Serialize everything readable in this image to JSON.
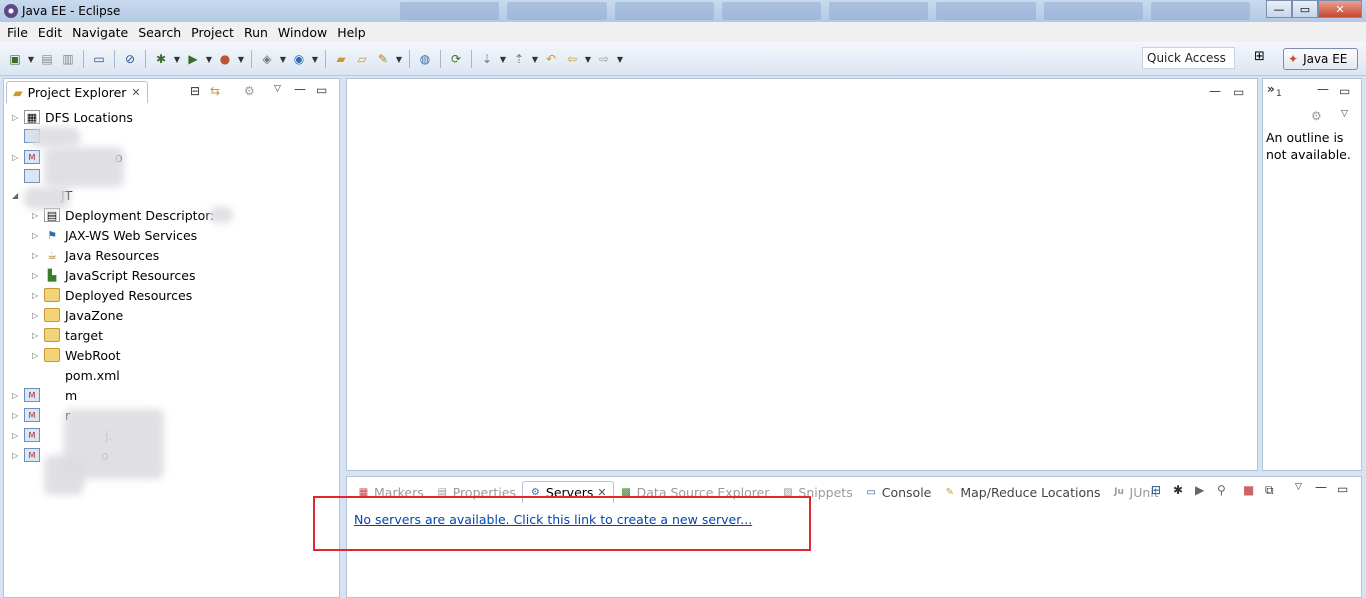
{
  "window": {
    "title": "Java EE - Eclipse",
    "min": "—",
    "max": "▭",
    "close": "✕"
  },
  "menu": [
    "File",
    "Edit",
    "Navigate",
    "Search",
    "Project",
    "Run",
    "Window",
    "Help"
  ],
  "toolbar": {
    "quick_access": "Quick Access",
    "perspective": "Java EE"
  },
  "explorer": {
    "tab_label": "Project Explorer",
    "items": [
      {
        "label": "DFS Locations"
      },
      {
        "label": ""
      },
      {
        "label": "o"
      },
      {
        "label": ""
      },
      {
        "label": "JT"
      },
      {
        "label": "Deployment Descriptor:"
      },
      {
        "label": "JAX-WS Web Services"
      },
      {
        "label": "Java Resources"
      },
      {
        "label": "JavaScript Resources"
      },
      {
        "label": "Deployed Resources"
      },
      {
        "label": "JavaZone"
      },
      {
        "label": "target"
      },
      {
        "label": "WebRoot"
      },
      {
        "label": "pom.xml"
      },
      {
        "label": "m"
      },
      {
        "label": "r"
      },
      {
        "label": "j."
      },
      {
        "label": "o"
      }
    ]
  },
  "outline": {
    "tab_label": "1",
    "message": "An outline is not available."
  },
  "bottom": {
    "tabs": [
      "Markers",
      "Properties",
      "Servers",
      "Data Source Explorer",
      "Snippets",
      "Console",
      "Map/Reduce Locations",
      "JUnit"
    ],
    "servers_link": "No servers are available. Click this link to create a new server..."
  }
}
